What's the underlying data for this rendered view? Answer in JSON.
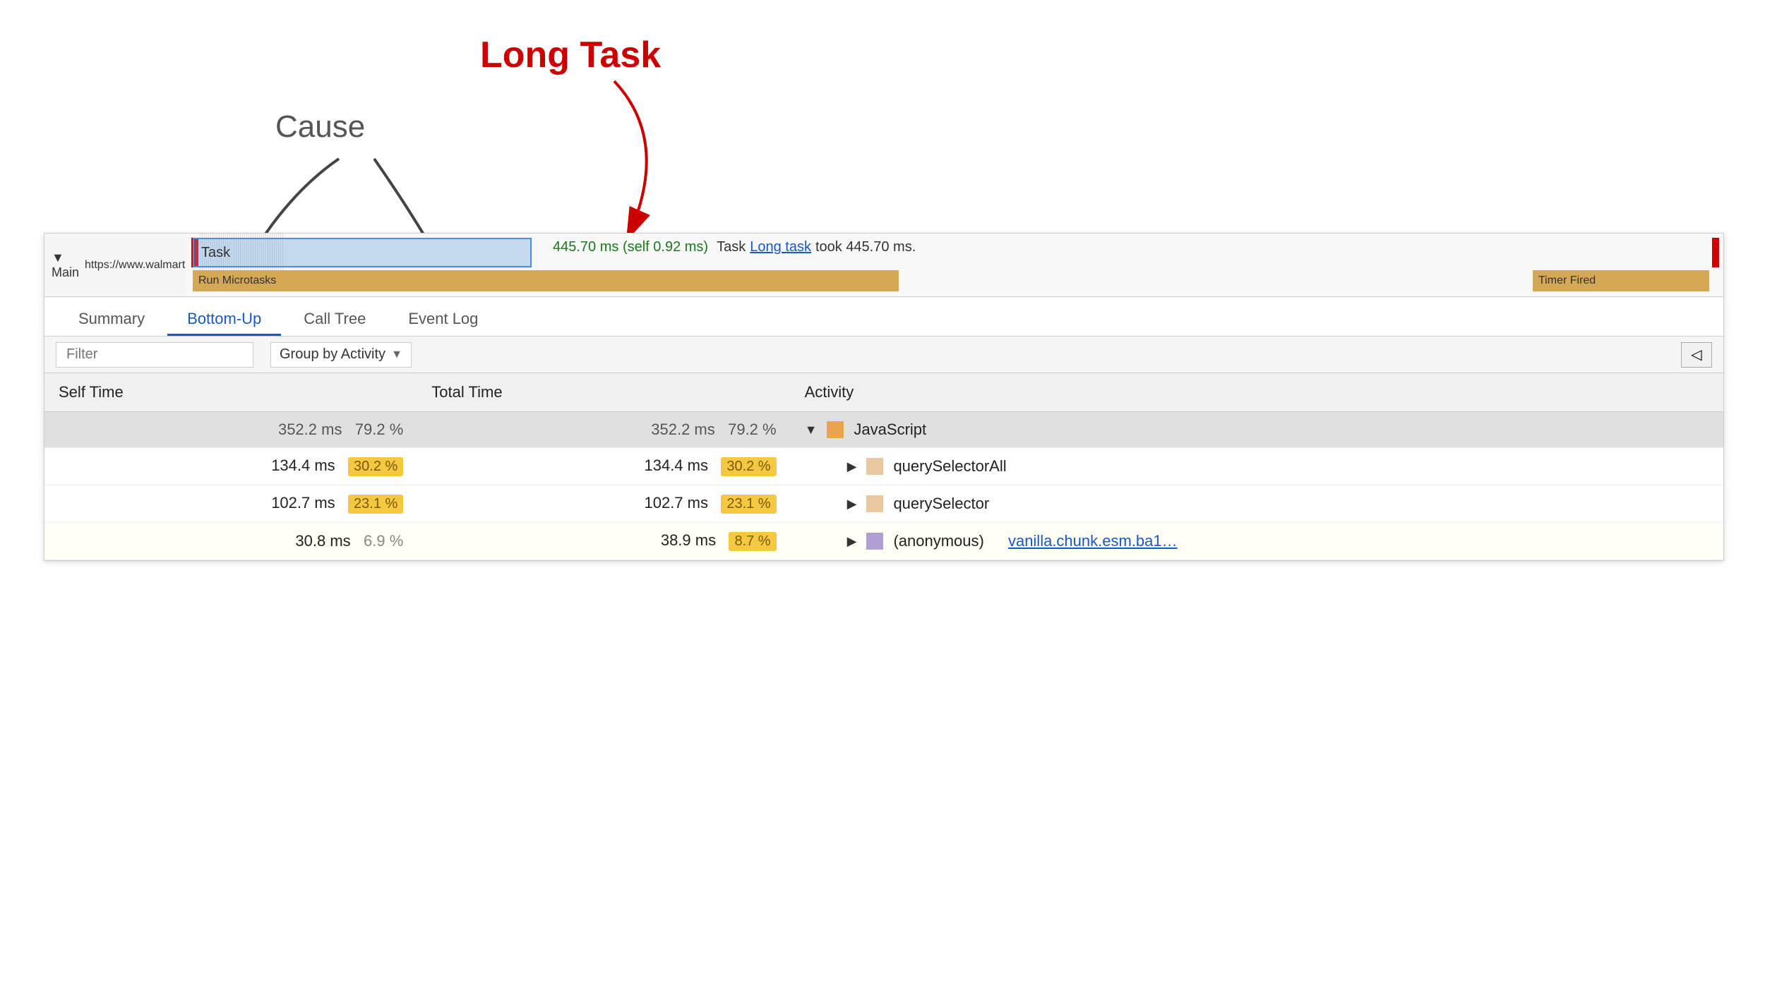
{
  "annotations": {
    "long_task_label": "Long Task",
    "cause_label": "Cause"
  },
  "timeline": {
    "main_label": "▼ Main",
    "url": "https://www.walmart.com",
    "task_label": "Task",
    "subtask_label": "Run Microtasks",
    "timer_label": "Timer Fired",
    "timing": "445.70 ms (self 0.92 ms)",
    "task_info": "Task",
    "task_link": "Long task",
    "task_suffix": "took 445.70 ms."
  },
  "tabs": [
    {
      "label": "Summary",
      "active": false
    },
    {
      "label": "Bottom-Up",
      "active": true
    },
    {
      "label": "Call Tree",
      "active": false
    },
    {
      "label": "Event Log",
      "active": false
    }
  ],
  "filter": {
    "placeholder": "Filter",
    "group_by": "Group by Activity"
  },
  "table": {
    "headers": [
      "Self Time",
      "Total Time",
      "Activity"
    ],
    "rows": [
      {
        "self_time": "352.2 ms",
        "self_pct": "79.2 %",
        "self_pct_type": "plain",
        "total_time": "352.2 ms",
        "total_pct": "79.2 %",
        "total_pct_type": "plain",
        "expand": "▼",
        "color": "#e8a54e",
        "activity": "JavaScript",
        "link": null,
        "is_header_row": true
      },
      {
        "self_time": "134.4 ms",
        "self_pct": "30.2 %",
        "self_pct_type": "yellow",
        "total_time": "134.4 ms",
        "total_pct": "30.2 %",
        "total_pct_type": "yellow",
        "expand": "▶",
        "color": "#e8c9a0",
        "activity": "querySelectorAll",
        "link": null,
        "is_header_row": false
      },
      {
        "self_time": "102.7 ms",
        "self_pct": "23.1 %",
        "self_pct_type": "yellow",
        "total_time": "102.7 ms",
        "total_pct": "23.1 %",
        "total_pct_type": "yellow",
        "expand": "▶",
        "color": "#e8c9a0",
        "activity": "querySelector",
        "link": null,
        "is_header_row": false
      },
      {
        "self_time": "30.8 ms",
        "self_pct": "6.9 %",
        "self_pct_type": "plain",
        "total_time": "38.9 ms",
        "total_pct": "8.7 %",
        "total_pct_type": "yellow",
        "expand": "▶",
        "color": "#b09fd0",
        "activity": "(anonymous)",
        "link": "vanilla.chunk.esm.ba1…",
        "is_header_row": false
      }
    ]
  },
  "colors": {
    "accent_blue": "#1a57c8",
    "long_task_red": "#cc0000",
    "timing_green": "#1a7a1a"
  }
}
